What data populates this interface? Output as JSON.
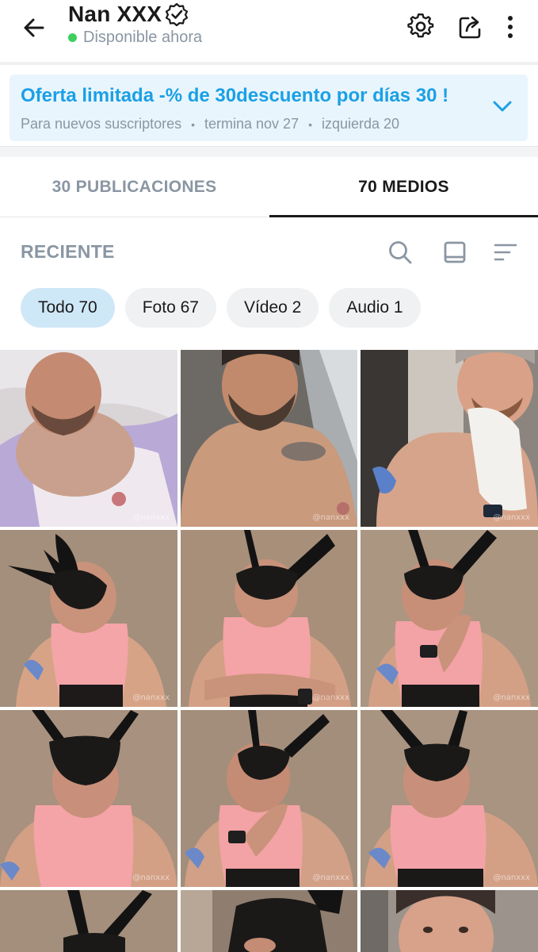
{
  "header": {
    "title": "Nan XXX",
    "status": "Disponible ahora",
    "status_color": "#3ecf5e",
    "icons": [
      "back-arrow-icon",
      "verified-icon",
      "gear-icon",
      "share-icon",
      "more-vertical-icon"
    ]
  },
  "offer": {
    "title": "Oferta limitada -% de 30descuento por días 30 !",
    "audience": "Para nuevos suscriptores",
    "ends": "termina nov 27",
    "remaining": "izquierda 20",
    "accent": "#1aa0e6"
  },
  "tabs": [
    {
      "label": "30 PUBLICACIONES",
      "active": false
    },
    {
      "label": "70 MEDIOS",
      "active": true
    }
  ],
  "sorter": {
    "label": "RECIENTE",
    "icons": [
      "search-icon",
      "layout-icon",
      "sort-icon"
    ]
  },
  "filters": [
    {
      "label": "Todo 70",
      "selected": true
    },
    {
      "label": "Foto 67",
      "selected": false
    },
    {
      "label": "Vídeo 2",
      "selected": false
    },
    {
      "label": "Audio 1",
      "selected": false
    }
  ],
  "media": {
    "watermark": "@nanxxx",
    "thumbnails": [
      "photo-man-lying-in-bed",
      "photo-shirtless-man-selfie",
      "photo-shirtless-man-with-towel",
      "photo-bunny-mask-pink-top",
      "photo-bunny-mask-arms-crossed",
      "photo-bunny-mask-hand-on-face",
      "photo-bunny-mask-front",
      "photo-bunny-mask-tongue",
      "photo-bunny-mask-portrait",
      "photo-bunny-mask-partial",
      "photo-bunny-mask-closeup",
      "photo-man-face-closeup"
    ]
  }
}
